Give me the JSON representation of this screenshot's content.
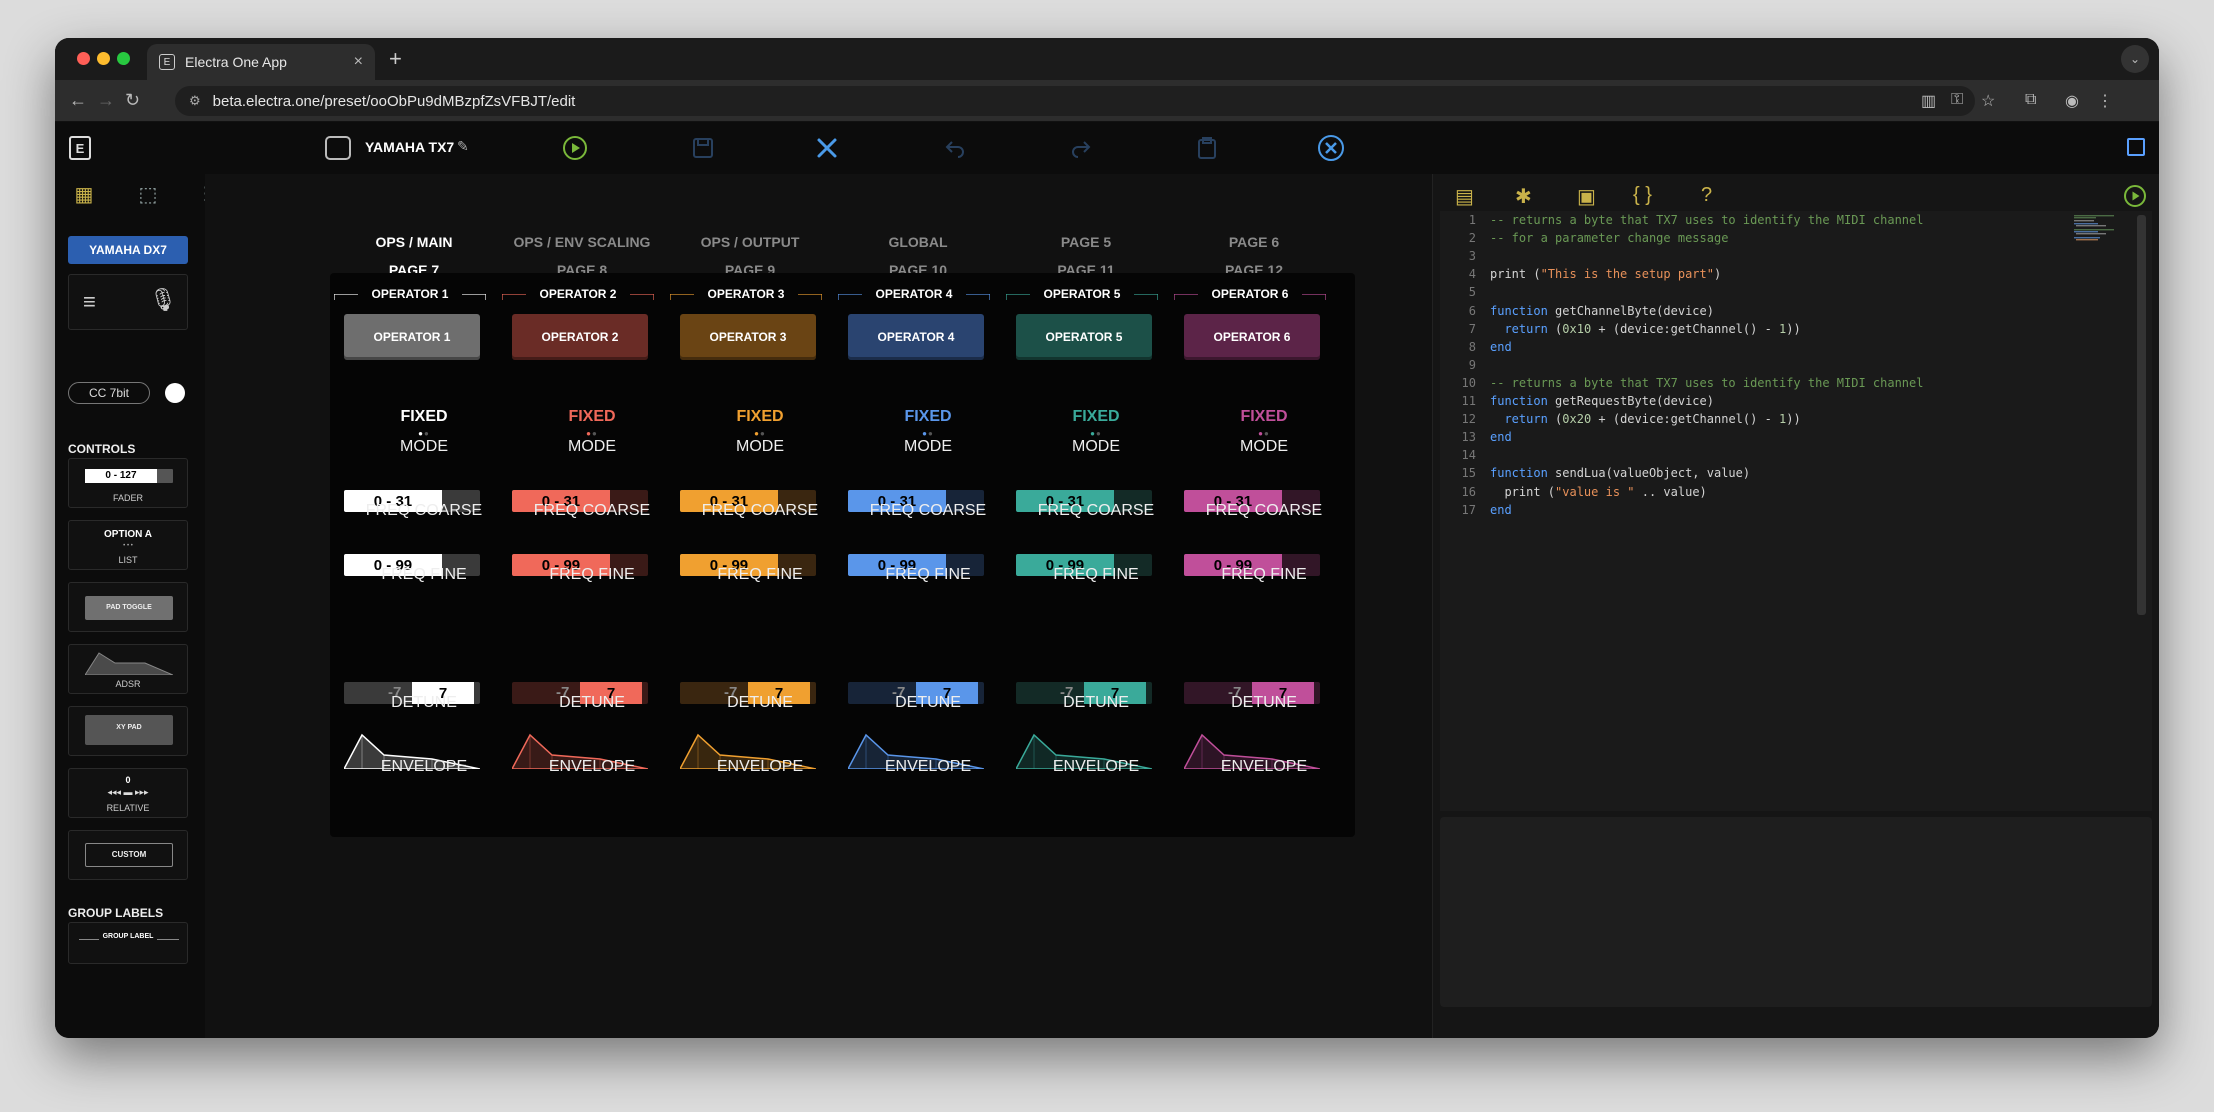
{
  "browser": {
    "tab_title": "Electra One App",
    "tab_icon": "E",
    "url": "beta.electra.one/preset/ooObPu9dMBzpfZsVFBJT/edit"
  },
  "app": {
    "logo": "E",
    "preset_name": "YAMAHA TX7"
  },
  "sidebar": {
    "device_button": "YAMAHA DX7",
    "cc_mode": "CC 7bit",
    "controls_heading": "CONTROLS",
    "controls": [
      {
        "label": "FADER",
        "preview": "0 - 127"
      },
      {
        "label": "LIST",
        "preview": "OPTION A"
      },
      {
        "label": "",
        "preview": "PAD TOGGLE"
      },
      {
        "label": "ADSR",
        "preview": ""
      },
      {
        "label": "",
        "preview": "XY PAD"
      },
      {
        "label": "RELATIVE",
        "preview": "0"
      },
      {
        "label": "",
        "preview": "CUSTOM"
      }
    ],
    "group_labels_heading": "GROUP LABELS",
    "group_label_preview": "GROUP LABEL"
  },
  "pages": [
    {
      "name": "OPS / MAIN",
      "number": "PAGE 7",
      "active": true
    },
    {
      "name": "OPS / ENV SCALING",
      "number": "PAGE 8",
      "active": false
    },
    {
      "name": "OPS / OUTPUT",
      "number": "PAGE 9",
      "active": false
    },
    {
      "name": "GLOBAL",
      "number": "PAGE 10",
      "active": false
    },
    {
      "name": "PAGE 5",
      "number": "PAGE 11",
      "active": false
    },
    {
      "name": "PAGE 6",
      "number": "PAGE 12",
      "active": false
    }
  ],
  "operators": [
    {
      "group": "OPERATOR 1",
      "pad": "OPERATOR 1",
      "mode": "FIXED",
      "mode_label": "MODE",
      "coarse": "0 - 31",
      "coarse_label": "FREQ COARSE",
      "fine": "0 - 99",
      "fine_label": "FREQ FINE",
      "detune_neg": "-7",
      "detune_pos": "7",
      "detune_label": "DETUNE",
      "env_label": "ENVELOPE",
      "color": "#ffffff",
      "pad_color": "#6e6e6e",
      "dark": "#3a3a3a",
      "text_on": "#000000"
    },
    {
      "group": "OPERATOR 2",
      "pad": "OPERATOR 2",
      "mode": "FIXED",
      "mode_label": "MODE",
      "coarse": "0 - 31",
      "coarse_label": "FREQ COARSE",
      "fine": "0 - 99",
      "fine_label": "FREQ FINE",
      "detune_neg": "-7",
      "detune_pos": "7",
      "detune_label": "DETUNE",
      "env_label": "ENVELOPE",
      "color": "#f0695a",
      "pad_color": "#6a2c26",
      "dark": "#3a1a17",
      "text_on": "#000000"
    },
    {
      "group": "OPERATOR 3",
      "pad": "OPERATOR 3",
      "mode": "FIXED",
      "mode_label": "MODE",
      "coarse": "0 - 31",
      "coarse_label": "FREQ COARSE",
      "fine": "0 - 99",
      "fine_label": "FREQ FINE",
      "detune_neg": "-7",
      "detune_pos": "7",
      "detune_label": "DETUNE",
      "env_label": "ENVELOPE",
      "color": "#f0a030",
      "pad_color": "#6a4414",
      "dark": "#3a2610",
      "text_on": "#000000"
    },
    {
      "group": "OPERATOR 4",
      "pad": "OPERATOR 4",
      "mode": "FIXED",
      "mode_label": "MODE",
      "coarse": "0 - 31",
      "coarse_label": "FREQ COARSE",
      "fine": "0 - 99",
      "fine_label": "FREQ FINE",
      "detune_neg": "-7",
      "detune_pos": "7",
      "detune_label": "DETUNE",
      "env_label": "ENVELOPE",
      "color": "#5a96ea",
      "pad_color": "#2a4470",
      "dark": "#172438",
      "text_on": "#000000"
    },
    {
      "group": "OPERATOR 5",
      "pad": "OPERATOR 5",
      "mode": "FIXED",
      "mode_label": "MODE",
      "coarse": "0 - 31",
      "coarse_label": "FREQ COARSE",
      "fine": "0 - 99",
      "fine_label": "FREQ FINE",
      "detune_neg": "-7",
      "detune_pos": "7",
      "detune_label": "DETUNE",
      "env_label": "ENVELOPE",
      "color": "#3aaa9a",
      "pad_color": "#1c5048",
      "dark": "#132a26",
      "text_on": "#000000"
    },
    {
      "group": "OPERATOR 6",
      "pad": "OPERATOR 6",
      "mode": "FIXED",
      "mode_label": "MODE",
      "coarse": "0 - 31",
      "coarse_label": "FREQ COARSE",
      "fine": "0 - 99",
      "fine_label": "FREQ FINE",
      "detune_neg": "-7",
      "detune_pos": "7",
      "detune_label": "DETUNE",
      "env_label": "ENVELOPE",
      "color": "#c04f9a",
      "pad_color": "#5c2448",
      "dark": "#321627",
      "text_on": "#000000"
    }
  ],
  "code": [
    {
      "n": "1",
      "text": "-- returns a byte that TX7 uses to identify the MIDI channel",
      "kind": "comment"
    },
    {
      "n": "2",
      "text": "-- for a parameter change message",
      "kind": "comment"
    },
    {
      "n": "3",
      "text": "",
      "kind": "plain"
    },
    {
      "n": "4",
      "text": "print (\"This is the setup part\")",
      "kind": "plain"
    },
    {
      "n": "5",
      "text": "",
      "kind": "plain"
    },
    {
      "n": "6",
      "text": "function getChannelByte(device)",
      "kind": "plain"
    },
    {
      "n": "7",
      "text": "  return (0x10 + (device:getChannel() - 1))",
      "kind": "plain"
    },
    {
      "n": "8",
      "text": "end",
      "kind": "plain"
    },
    {
      "n": "9",
      "text": "",
      "kind": "plain"
    },
    {
      "n": "10",
      "text": "-- returns a byte that TX7 uses to identify the MIDI channel",
      "kind": "comment"
    },
    {
      "n": "11",
      "text": "function getRequestByte(device)",
      "kind": "plain"
    },
    {
      "n": "12",
      "text": "  return (0x20 + (device:getChannel() - 1))",
      "kind": "plain"
    },
    {
      "n": "13",
      "text": "end",
      "kind": "plain"
    },
    {
      "n": "14",
      "text": "",
      "kind": "plain"
    },
    {
      "n": "15",
      "text": "function sendLua(valueObject, value)",
      "kind": "plain"
    },
    {
      "n": "16",
      "text": "  print (\"value is \" .. value)",
      "kind": "plain"
    },
    {
      "n": "17",
      "text": "end",
      "kind": "plain"
    }
  ],
  "colors": {
    "keyword": "#5aa0ff",
    "comment": "#6a9955",
    "string": "#e8915a",
    "number": "#b5cea8",
    "accent": "#2c5fb0"
  }
}
